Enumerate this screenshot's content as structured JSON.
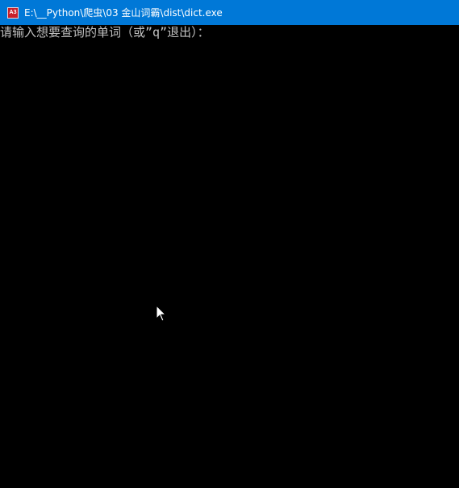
{
  "window": {
    "title": "E:\\__Python\\爬虫\\03 金山词霸\\dist\\dict.exe",
    "icon": "console-app-icon",
    "icon_glyph": "A3",
    "titlebar_color": "#0078d7",
    "background_color": "#000000",
    "text_color": "#c0c0c0"
  },
  "console": {
    "lines": [
      "请输入想要查询的单词（或”q”退出）："
    ]
  },
  "pointer": {
    "icon": "mouse-pointer-icon"
  }
}
